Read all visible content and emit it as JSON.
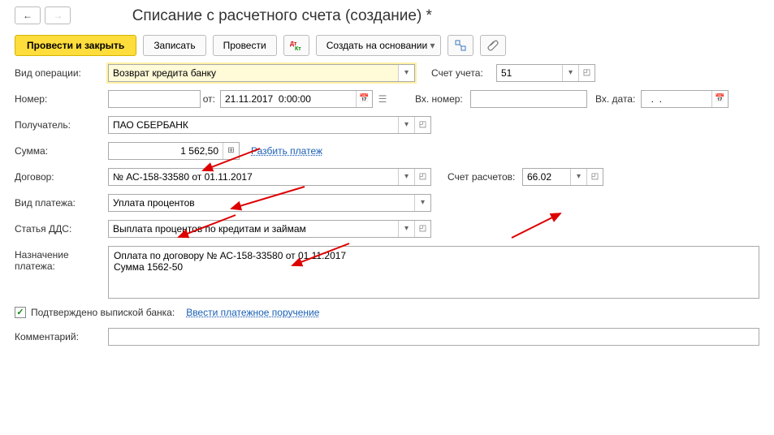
{
  "title": "Списание с расчетного счета (создание) *",
  "toolbar": {
    "post_close": "Провести и закрыть",
    "save": "Записать",
    "post": "Провести",
    "create_based": "Создать на основании"
  },
  "labels": {
    "operation_type": "Вид операции:",
    "account": "Счет учета:",
    "number": "Номер:",
    "from": "от:",
    "in_number": "Вх. номер:",
    "in_date": "Вх. дата:",
    "recipient": "Получатель:",
    "sum": "Сумма:",
    "split": "Разбить платеж",
    "contract": "Договор:",
    "settle_account": "Счет расчетов:",
    "payment_type": "Вид платежа:",
    "dds": "Статья ДДС:",
    "purpose": "Назначение платежа:",
    "confirmed": "Подтверждено выпиской банка:",
    "enter_order": "Ввести платежное поручение",
    "comment": "Комментарий:"
  },
  "values": {
    "operation_type": "Возврат кредита банку",
    "account": "51",
    "number": "",
    "date": "21.11.2017  0:00:00",
    "in_number": "",
    "in_date": "  .  .     ",
    "recipient": "ПАО СБЕРБАНК",
    "sum": "1 562,50",
    "contract": "№ АС-158-33580 от 01.11.2017",
    "settle_account": "66.02",
    "payment_type": "Уплата процентов",
    "dds": "Выплата процентов по кредитам и займам",
    "purpose": "Оплата по договору № АС-158-33580 от 01.11.2017\nСумма 1562-50",
    "confirmed": true,
    "comment": ""
  }
}
